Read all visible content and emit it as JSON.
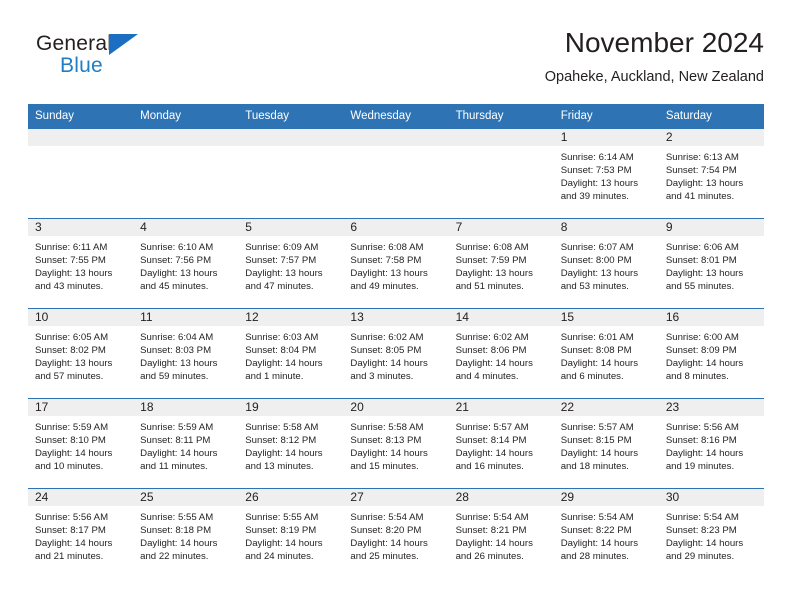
{
  "brand": {
    "name_part1": "General",
    "name_part2": "Blue",
    "triangle_icon": "triangle-icon",
    "color_dark": "#231f20",
    "color_blue": "#1f7ec4"
  },
  "header": {
    "title": "November 2024",
    "subtitle": "Opaheke, Auckland, New Zealand"
  },
  "theme": {
    "header_blue": "#2e74b5",
    "daynum_band": "#efefef",
    "cell_background": "#ffffff",
    "text": "#231f20"
  },
  "weekdays": [
    "Sunday",
    "Monday",
    "Tuesday",
    "Wednesday",
    "Thursday",
    "Friday",
    "Saturday"
  ],
  "weeks": [
    [
      {
        "day": "",
        "sunrise": "",
        "sunset": "",
        "daylight_line1": "",
        "daylight_line2": ""
      },
      {
        "day": "",
        "sunrise": "",
        "sunset": "",
        "daylight_line1": "",
        "daylight_line2": ""
      },
      {
        "day": "",
        "sunrise": "",
        "sunset": "",
        "daylight_line1": "",
        "daylight_line2": ""
      },
      {
        "day": "",
        "sunrise": "",
        "sunset": "",
        "daylight_line1": "",
        "daylight_line2": ""
      },
      {
        "day": "",
        "sunrise": "",
        "sunset": "",
        "daylight_line1": "",
        "daylight_line2": ""
      },
      {
        "day": "1",
        "sunrise": "Sunrise: 6:14 AM",
        "sunset": "Sunset: 7:53 PM",
        "daylight_line1": "Daylight: 13 hours",
        "daylight_line2": "and 39 minutes."
      },
      {
        "day": "2",
        "sunrise": "Sunrise: 6:13 AM",
        "sunset": "Sunset: 7:54 PM",
        "daylight_line1": "Daylight: 13 hours",
        "daylight_line2": "and 41 minutes."
      }
    ],
    [
      {
        "day": "3",
        "sunrise": "Sunrise: 6:11 AM",
        "sunset": "Sunset: 7:55 PM",
        "daylight_line1": "Daylight: 13 hours",
        "daylight_line2": "and 43 minutes."
      },
      {
        "day": "4",
        "sunrise": "Sunrise: 6:10 AM",
        "sunset": "Sunset: 7:56 PM",
        "daylight_line1": "Daylight: 13 hours",
        "daylight_line2": "and 45 minutes."
      },
      {
        "day": "5",
        "sunrise": "Sunrise: 6:09 AM",
        "sunset": "Sunset: 7:57 PM",
        "daylight_line1": "Daylight: 13 hours",
        "daylight_line2": "and 47 minutes."
      },
      {
        "day": "6",
        "sunrise": "Sunrise: 6:08 AM",
        "sunset": "Sunset: 7:58 PM",
        "daylight_line1": "Daylight: 13 hours",
        "daylight_line2": "and 49 minutes."
      },
      {
        "day": "7",
        "sunrise": "Sunrise: 6:08 AM",
        "sunset": "Sunset: 7:59 PM",
        "daylight_line1": "Daylight: 13 hours",
        "daylight_line2": "and 51 minutes."
      },
      {
        "day": "8",
        "sunrise": "Sunrise: 6:07 AM",
        "sunset": "Sunset: 8:00 PM",
        "daylight_line1": "Daylight: 13 hours",
        "daylight_line2": "and 53 minutes."
      },
      {
        "day": "9",
        "sunrise": "Sunrise: 6:06 AM",
        "sunset": "Sunset: 8:01 PM",
        "daylight_line1": "Daylight: 13 hours",
        "daylight_line2": "and 55 minutes."
      }
    ],
    [
      {
        "day": "10",
        "sunrise": "Sunrise: 6:05 AM",
        "sunset": "Sunset: 8:02 PM",
        "daylight_line1": "Daylight: 13 hours",
        "daylight_line2": "and 57 minutes."
      },
      {
        "day": "11",
        "sunrise": "Sunrise: 6:04 AM",
        "sunset": "Sunset: 8:03 PM",
        "daylight_line1": "Daylight: 13 hours",
        "daylight_line2": "and 59 minutes."
      },
      {
        "day": "12",
        "sunrise": "Sunrise: 6:03 AM",
        "sunset": "Sunset: 8:04 PM",
        "daylight_line1": "Daylight: 14 hours",
        "daylight_line2": "and 1 minute."
      },
      {
        "day": "13",
        "sunrise": "Sunrise: 6:02 AM",
        "sunset": "Sunset: 8:05 PM",
        "daylight_line1": "Daylight: 14 hours",
        "daylight_line2": "and 3 minutes."
      },
      {
        "day": "14",
        "sunrise": "Sunrise: 6:02 AM",
        "sunset": "Sunset: 8:06 PM",
        "daylight_line1": "Daylight: 14 hours",
        "daylight_line2": "and 4 minutes."
      },
      {
        "day": "15",
        "sunrise": "Sunrise: 6:01 AM",
        "sunset": "Sunset: 8:08 PM",
        "daylight_line1": "Daylight: 14 hours",
        "daylight_line2": "and 6 minutes."
      },
      {
        "day": "16",
        "sunrise": "Sunrise: 6:00 AM",
        "sunset": "Sunset: 8:09 PM",
        "daylight_line1": "Daylight: 14 hours",
        "daylight_line2": "and 8 minutes."
      }
    ],
    [
      {
        "day": "17",
        "sunrise": "Sunrise: 5:59 AM",
        "sunset": "Sunset: 8:10 PM",
        "daylight_line1": "Daylight: 14 hours",
        "daylight_line2": "and 10 minutes."
      },
      {
        "day": "18",
        "sunrise": "Sunrise: 5:59 AM",
        "sunset": "Sunset: 8:11 PM",
        "daylight_line1": "Daylight: 14 hours",
        "daylight_line2": "and 11 minutes."
      },
      {
        "day": "19",
        "sunrise": "Sunrise: 5:58 AM",
        "sunset": "Sunset: 8:12 PM",
        "daylight_line1": "Daylight: 14 hours",
        "daylight_line2": "and 13 minutes."
      },
      {
        "day": "20",
        "sunrise": "Sunrise: 5:58 AM",
        "sunset": "Sunset: 8:13 PM",
        "daylight_line1": "Daylight: 14 hours",
        "daylight_line2": "and 15 minutes."
      },
      {
        "day": "21",
        "sunrise": "Sunrise: 5:57 AM",
        "sunset": "Sunset: 8:14 PM",
        "daylight_line1": "Daylight: 14 hours",
        "daylight_line2": "and 16 minutes."
      },
      {
        "day": "22",
        "sunrise": "Sunrise: 5:57 AM",
        "sunset": "Sunset: 8:15 PM",
        "daylight_line1": "Daylight: 14 hours",
        "daylight_line2": "and 18 minutes."
      },
      {
        "day": "23",
        "sunrise": "Sunrise: 5:56 AM",
        "sunset": "Sunset: 8:16 PM",
        "daylight_line1": "Daylight: 14 hours",
        "daylight_line2": "and 19 minutes."
      }
    ],
    [
      {
        "day": "24",
        "sunrise": "Sunrise: 5:56 AM",
        "sunset": "Sunset: 8:17 PM",
        "daylight_line1": "Daylight: 14 hours",
        "daylight_line2": "and 21 minutes."
      },
      {
        "day": "25",
        "sunrise": "Sunrise: 5:55 AM",
        "sunset": "Sunset: 8:18 PM",
        "daylight_line1": "Daylight: 14 hours",
        "daylight_line2": "and 22 minutes."
      },
      {
        "day": "26",
        "sunrise": "Sunrise: 5:55 AM",
        "sunset": "Sunset: 8:19 PM",
        "daylight_line1": "Daylight: 14 hours",
        "daylight_line2": "and 24 minutes."
      },
      {
        "day": "27",
        "sunrise": "Sunrise: 5:54 AM",
        "sunset": "Sunset: 8:20 PM",
        "daylight_line1": "Daylight: 14 hours",
        "daylight_line2": "and 25 minutes."
      },
      {
        "day": "28",
        "sunrise": "Sunrise: 5:54 AM",
        "sunset": "Sunset: 8:21 PM",
        "daylight_line1": "Daylight: 14 hours",
        "daylight_line2": "and 26 minutes."
      },
      {
        "day": "29",
        "sunrise": "Sunrise: 5:54 AM",
        "sunset": "Sunset: 8:22 PM",
        "daylight_line1": "Daylight: 14 hours",
        "daylight_line2": "and 28 minutes."
      },
      {
        "day": "30",
        "sunrise": "Sunrise: 5:54 AM",
        "sunset": "Sunset: 8:23 PM",
        "daylight_line1": "Daylight: 14 hours",
        "daylight_line2": "and 29 minutes."
      }
    ]
  ]
}
